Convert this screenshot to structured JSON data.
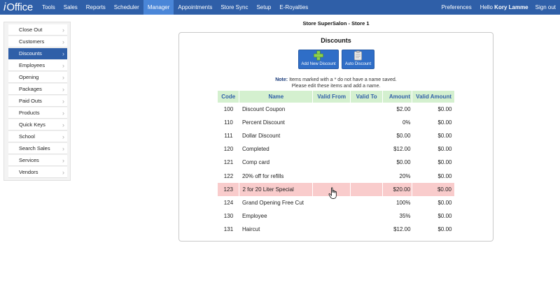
{
  "app": {
    "brand": "iOffice",
    "nav": [
      "Tools",
      "Sales",
      "Reports",
      "Scheduler",
      "Manager",
      "Appointments",
      "Store Sync",
      "Setup",
      "E-Royalties"
    ],
    "active_nav": "Manager",
    "preferences": "Preferences",
    "hello_prefix": "Hello",
    "user_name": "Kory Lamme",
    "sign_out": "Sign out"
  },
  "sidebar": {
    "items": [
      "Close Out",
      "Customers",
      "Discounts",
      "Employees",
      "Opening",
      "Packages",
      "Paid Outs",
      "Products",
      "Quick Keys",
      "School",
      "Search Sales",
      "Services",
      "Vendors"
    ],
    "active": "Discounts"
  },
  "store_title": "Store SuperSalon - Store 1",
  "panel": {
    "title": "Discounts",
    "add_button": "Add New Discount",
    "auto_button": "Auto Discount",
    "note_label": "Note:",
    "note_line1": "Items marked with a * do not have a name saved.",
    "note_line2": "Please edit these items and add a name."
  },
  "table": {
    "headers": [
      "Code",
      "Name",
      "Valid From",
      "Valid To",
      "Amount",
      "Valid Amount"
    ],
    "rows": [
      [
        "100",
        "Discount Coupon",
        "",
        "",
        "$2.00",
        "$0.00"
      ],
      [
        "110",
        "Percent Discount",
        "",
        "",
        "0%",
        "$0.00"
      ],
      [
        "111",
        "Dollar Discount",
        "",
        "",
        "$0.00",
        "$0.00"
      ],
      [
        "120",
        "Completed",
        "",
        "",
        "$12.00",
        "$0.00"
      ],
      [
        "121",
        "Comp card",
        "",
        "",
        "$0.00",
        "$0.00"
      ],
      [
        "122",
        "20% off for refills",
        "",
        "",
        "20%",
        "$0.00"
      ],
      [
        "123",
        "2 for 20 Liter Special",
        "",
        "",
        "$20.00",
        "$0.00"
      ],
      [
        "124",
        "Grand Opening Free Cut",
        "",
        "",
        "100%",
        "$0.00"
      ],
      [
        "130",
        "Employee",
        "",
        "",
        "35%",
        "$0.00"
      ],
      [
        "131",
        "Haircut",
        "",
        "",
        "$12.00",
        "$0.00"
      ]
    ],
    "highlighted_row": 6
  },
  "colors": {
    "nav_bg": "#2f5fa8",
    "nav_active": "#4a86d8",
    "header_bg": "#d4f0cf",
    "header_text": "#2f5fa8",
    "highlight_row": "#f9cccc"
  }
}
